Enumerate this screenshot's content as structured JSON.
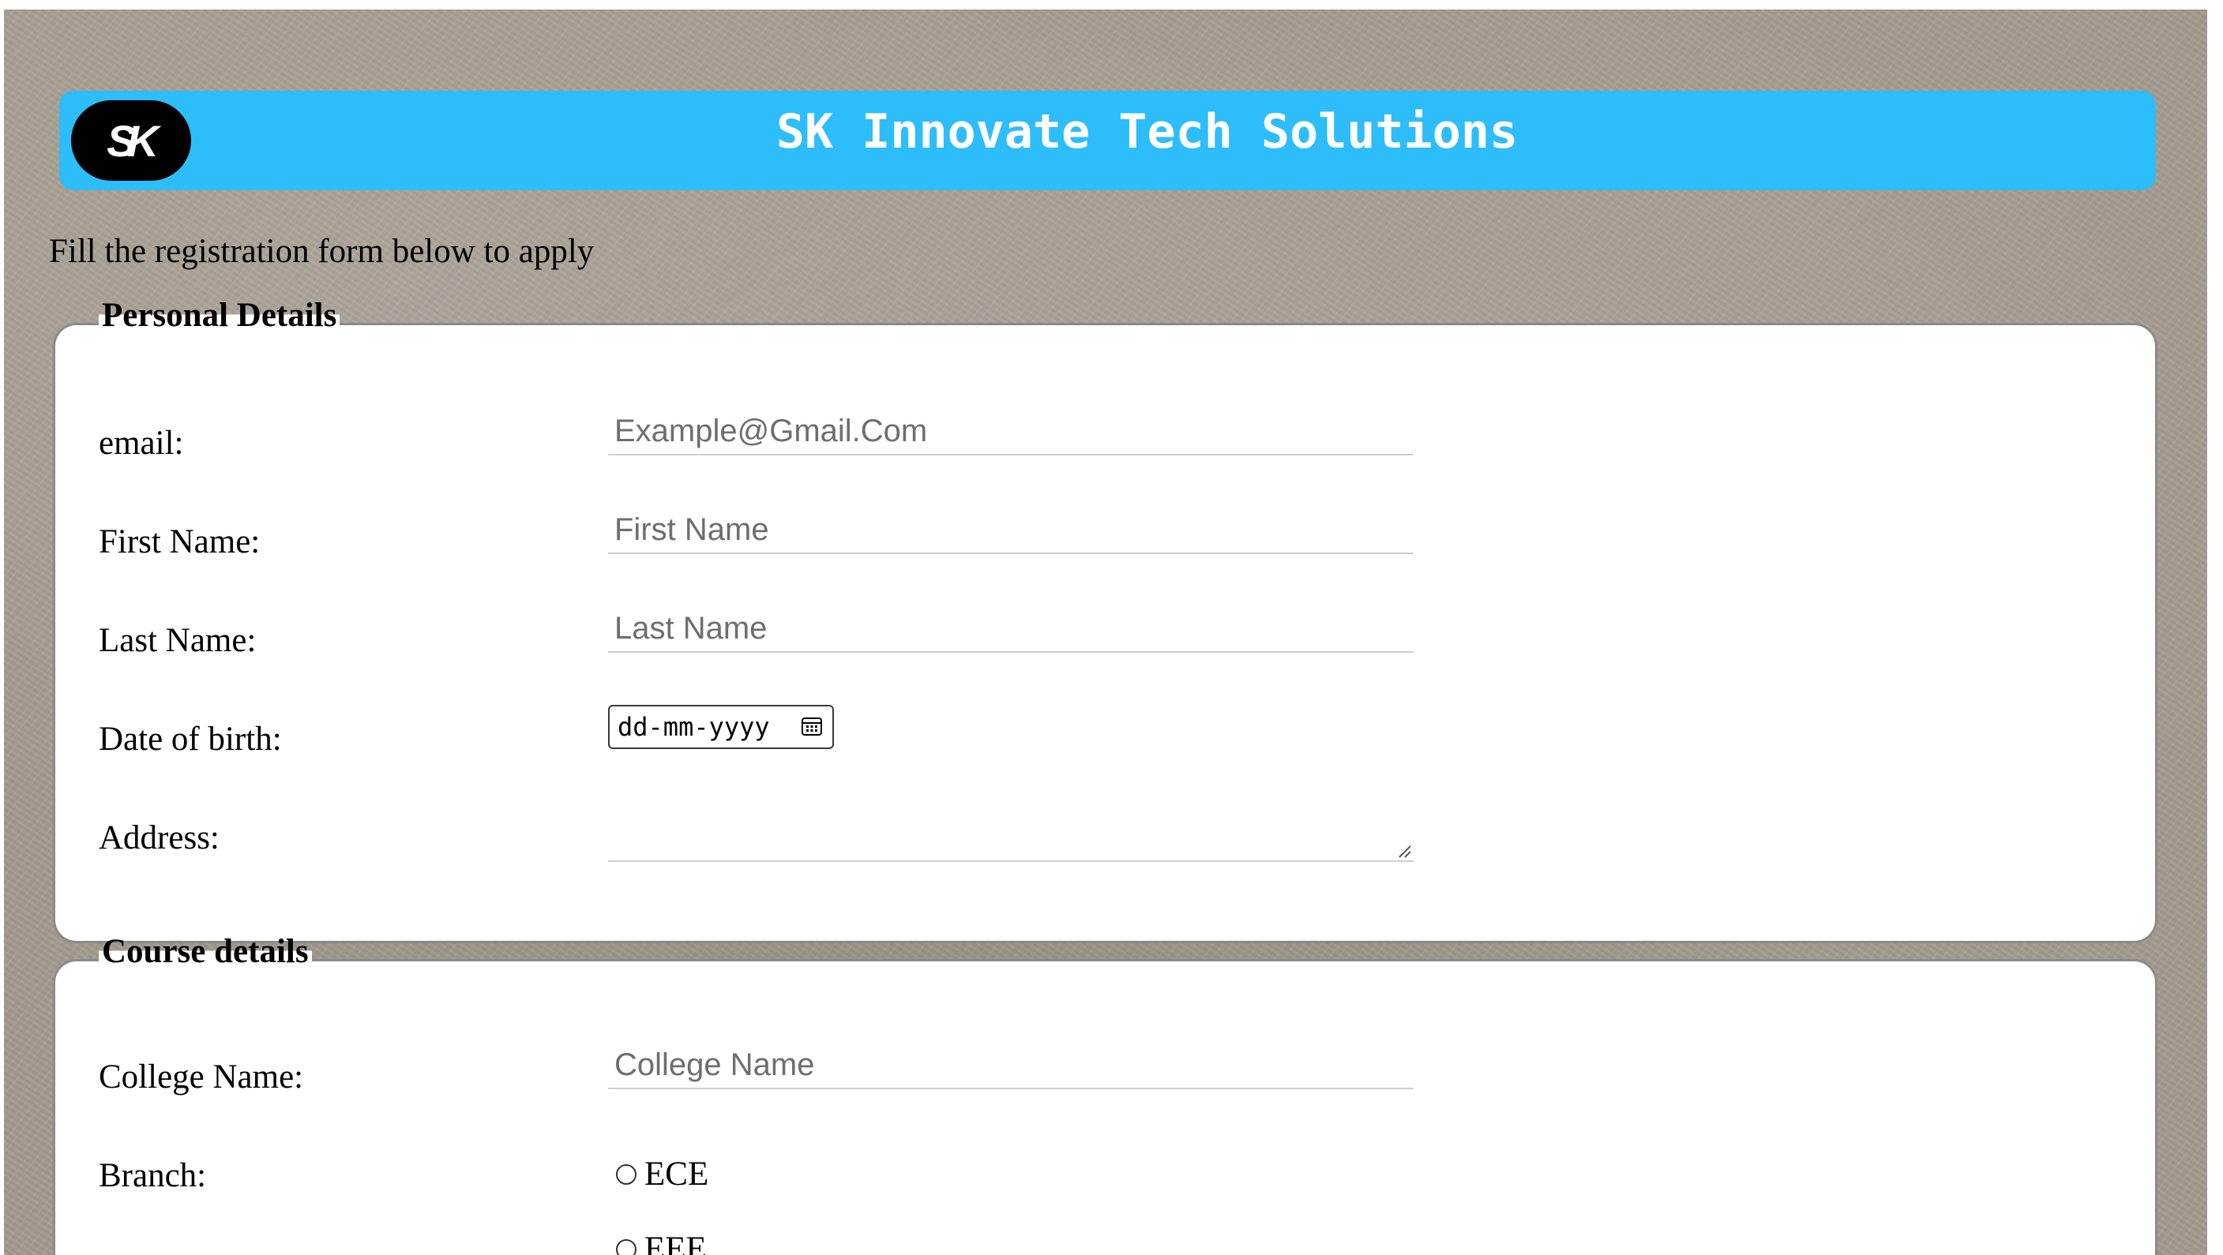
{
  "header": {
    "logo_text": "SK",
    "title": "SK Innovate Tech Solutions"
  },
  "intro": "Fill the registration form below to apply",
  "personal": {
    "legend": "Personal Details",
    "email": {
      "label": "email:",
      "placeholder": "Example@Gmail.Com"
    },
    "first_name": {
      "label": "First Name:",
      "placeholder": "First Name"
    },
    "last_name": {
      "label": "Last Name:",
      "placeholder": "Last Name"
    },
    "dob": {
      "label": "Date of birth:",
      "placeholder": "dd-mm-yyyy",
      "icon": "calendar-icon"
    },
    "address": {
      "label": "Address:",
      "icon": "resize-handle-icon"
    }
  },
  "course": {
    "legend": "Course details",
    "college": {
      "label": "College Name:",
      "placeholder": "College Name"
    },
    "branch": {
      "label": "Branch:",
      "options": [
        "ECE",
        "EEE"
      ]
    }
  },
  "colors": {
    "header_bg": "#2dbdfb",
    "page_bg": "#a69d90",
    "logo_bg": "#000000"
  }
}
